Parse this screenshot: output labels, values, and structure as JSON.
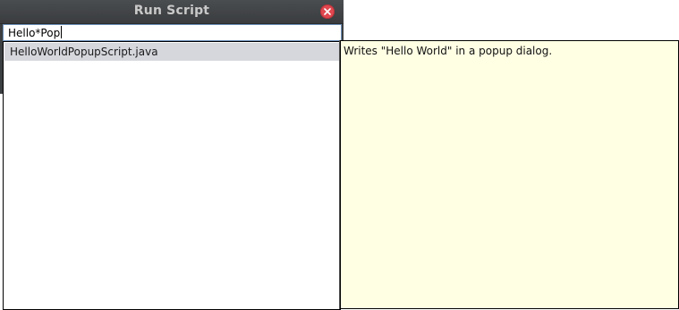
{
  "window": {
    "title": "Run Script"
  },
  "search": {
    "value": "Hello*Pop"
  },
  "results": {
    "items": [
      {
        "label": "HelloWorldPopupScript.java",
        "selected": true
      }
    ]
  },
  "description": {
    "text": "Writes \"Hello World\" in a popup dialog."
  },
  "icons": {
    "close": "close-icon"
  },
  "colors": {
    "titlebar": "#3c3f41",
    "close_button": "#e0474f",
    "selection": "#d6d7dd",
    "tooltip_background": "#ffffe4"
  }
}
